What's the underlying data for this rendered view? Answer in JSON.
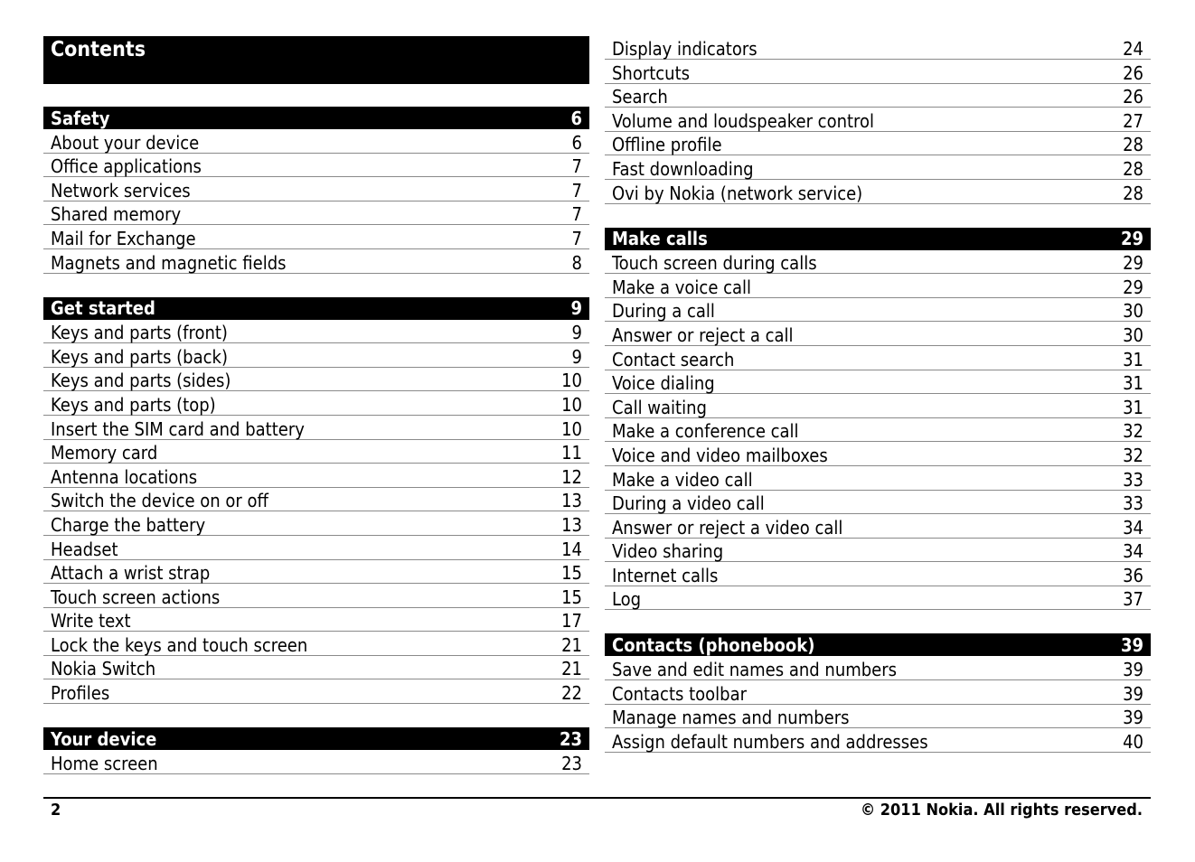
{
  "title": "Contents",
  "left_sections": [
    {
      "title": "Safety",
      "page": "6",
      "items": [
        {
          "label": "About your device",
          "page": "6"
        },
        {
          "label": "Office applications",
          "page": "7"
        },
        {
          "label": "Network services",
          "page": "7"
        },
        {
          "label": "Shared memory",
          "page": "7"
        },
        {
          "label": "Mail for Exchange",
          "page": "7"
        },
        {
          "label": "Magnets and magnetic fields",
          "page": "8"
        }
      ]
    },
    {
      "title": "Get started",
      "page": "9",
      "items": [
        {
          "label": "Keys and parts (front)",
          "page": "9"
        },
        {
          "label": "Keys and parts (back)",
          "page": "9"
        },
        {
          "label": "Keys and parts (sides)",
          "page": "10"
        },
        {
          "label": "Keys and parts (top)",
          "page": "10"
        },
        {
          "label": "Insert the SIM card and battery",
          "page": "10"
        },
        {
          "label": "Memory card",
          "page": "11"
        },
        {
          "label": "Antenna locations",
          "page": "12"
        },
        {
          "label": "Switch the device on or off",
          "page": "13"
        },
        {
          "label": "Charge the battery",
          "page": "13"
        },
        {
          "label": "Headset",
          "page": "14"
        },
        {
          "label": "Attach a wrist strap",
          "page": "15"
        },
        {
          "label": "Touch screen actions",
          "page": "15"
        },
        {
          "label": "Write text",
          "page": "17"
        },
        {
          "label": "Lock the keys and touch screen",
          "page": "21"
        },
        {
          "label": "Nokia Switch",
          "page": "21"
        },
        {
          "label": "Profiles",
          "page": "22"
        }
      ]
    },
    {
      "title": "Your device",
      "page": "23",
      "items": [
        {
          "label": "Home screen",
          "page": "23"
        }
      ]
    }
  ],
  "right_continued": [
    {
      "label": "Display indicators",
      "page": "24"
    },
    {
      "label": "Shortcuts",
      "page": "26"
    },
    {
      "label": "Search",
      "page": "26"
    },
    {
      "label": "Volume and loudspeaker control",
      "page": "27"
    },
    {
      "label": "Offline profile",
      "page": "28"
    },
    {
      "label": "Fast downloading",
      "page": "28"
    },
    {
      "label": "Ovi by Nokia (network service)",
      "page": "28"
    }
  ],
  "right_sections": [
    {
      "title": "Make calls",
      "page": "29",
      "items": [
        {
          "label": "Touch screen during calls",
          "page": "29"
        },
        {
          "label": "Make a voice call",
          "page": "29"
        },
        {
          "label": "During a call",
          "page": "30"
        },
        {
          "label": "Answer or reject a call",
          "page": "30"
        },
        {
          "label": "Contact search",
          "page": "31"
        },
        {
          "label": "Voice dialing",
          "page": "31"
        },
        {
          "label": "Call waiting",
          "page": "31"
        },
        {
          "label": "Make a conference call",
          "page": "32"
        },
        {
          "label": "Voice and video mailboxes",
          "page": "32"
        },
        {
          "label": "Make a video call",
          "page": "33"
        },
        {
          "label": "During a video call",
          "page": "33"
        },
        {
          "label": "Answer or reject a video call",
          "page": "34"
        },
        {
          "label": "Video sharing",
          "page": "34"
        },
        {
          "label": "Internet calls",
          "page": "36"
        },
        {
          "label": "Log",
          "page": "37"
        }
      ]
    },
    {
      "title": "Contacts (phonebook)",
      "page": "39",
      "items": [
        {
          "label": "Save and edit names and numbers",
          "page": "39"
        },
        {
          "label": "Contacts toolbar",
          "page": "39"
        },
        {
          "label": "Manage names and numbers",
          "page": "39"
        },
        {
          "label": "Assign default numbers and addresses",
          "page": "40"
        }
      ]
    }
  ],
  "footer": {
    "page_number": "2",
    "copyright": "© 2011 Nokia. All rights reserved."
  }
}
